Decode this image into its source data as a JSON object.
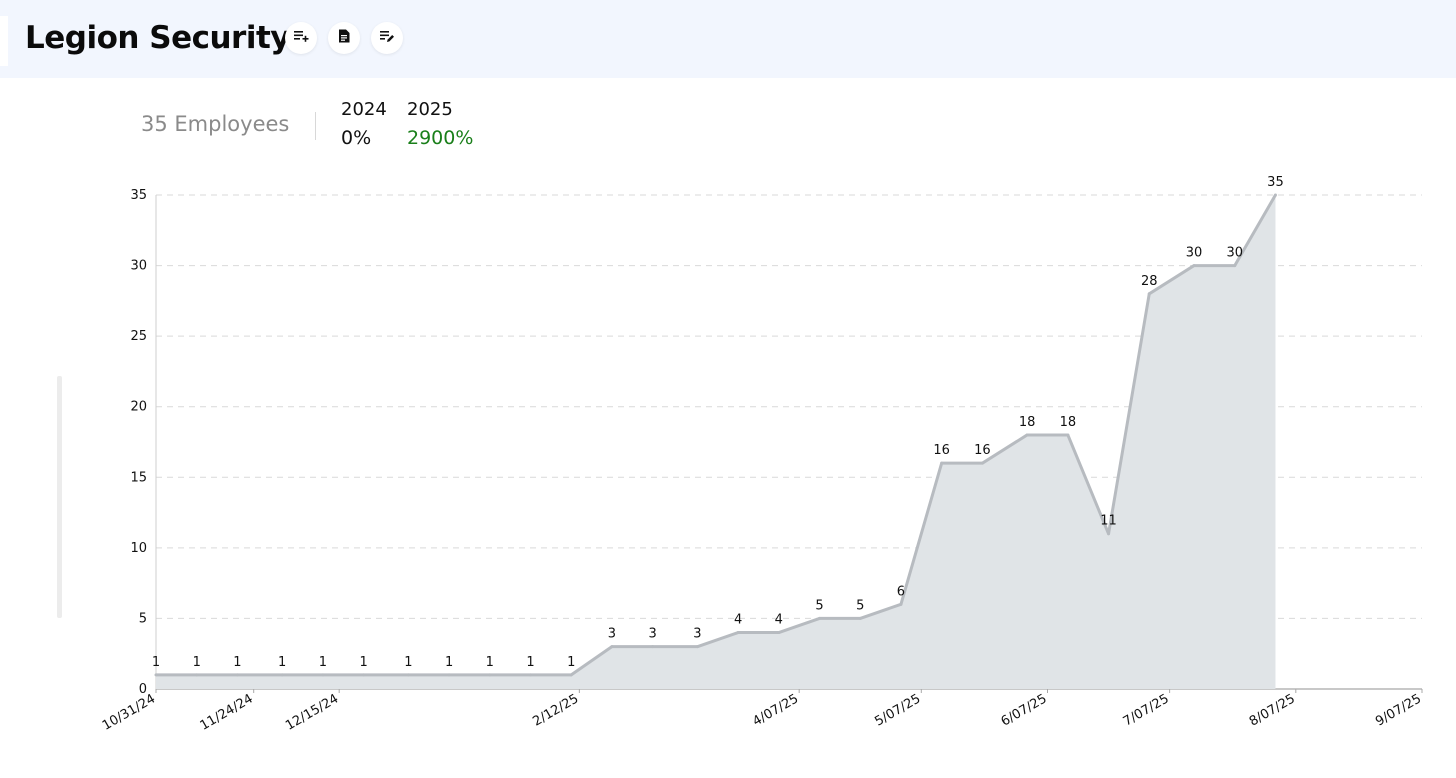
{
  "header": {
    "title": "Legion Security",
    "buttons": [
      {
        "icon": "add-to-list-icon"
      },
      {
        "icon": "document-icon"
      },
      {
        "icon": "edit-list-icon"
      }
    ]
  },
  "stats": {
    "employees_label": "35 Employees",
    "years": [
      {
        "year": "2024",
        "growth": "0%",
        "color": "#111111"
      },
      {
        "year": "2025",
        "growth": "2900%",
        "color": "#1a7f1a"
      }
    ]
  },
  "chart_data": {
    "type": "area",
    "ylim": [
      0,
      35
    ],
    "yticks": [
      "0",
      "5",
      "10",
      "15",
      "20",
      "25",
      "30",
      "35"
    ],
    "xlim": [
      "2024-10-31",
      "2025-09-07"
    ],
    "xticks": [
      "10/31/24",
      "11/24/24",
      "12/15/24",
      "2/12/25",
      "4/07/25",
      "5/07/25",
      "6/07/25",
      "7/07/25",
      "8/07/25",
      "9/07/25"
    ],
    "xtick_dates": [
      "2024-10-31",
      "2024-11-24",
      "2024-12-15",
      "2025-02-12",
      "2025-04-07",
      "2025-05-07",
      "2025-06-07",
      "2025-07-07",
      "2025-08-07",
      "2025-09-07"
    ],
    "points": [
      {
        "date": "2024-10-31",
        "value": 1
      },
      {
        "date": "2024-11-10",
        "value": 1
      },
      {
        "date": "2024-11-20",
        "value": 1
      },
      {
        "date": "2024-12-01",
        "value": 1
      },
      {
        "date": "2024-12-11",
        "value": 1
      },
      {
        "date": "2024-12-21",
        "value": 1
      },
      {
        "date": "2025-01-01",
        "value": 1
      },
      {
        "date": "2025-01-11",
        "value": 1
      },
      {
        "date": "2025-01-21",
        "value": 1
      },
      {
        "date": "2025-01-31",
        "value": 1
      },
      {
        "date": "2025-02-10",
        "value": 1
      },
      {
        "date": "2025-02-20",
        "value": 3
      },
      {
        "date": "2025-03-02",
        "value": 3
      },
      {
        "date": "2025-03-13",
        "value": 3
      },
      {
        "date": "2025-03-23",
        "value": 4
      },
      {
        "date": "2025-04-02",
        "value": 4
      },
      {
        "date": "2025-04-12",
        "value": 5
      },
      {
        "date": "2025-04-22",
        "value": 5
      },
      {
        "date": "2025-05-02",
        "value": 6
      },
      {
        "date": "2025-05-12",
        "value": 16
      },
      {
        "date": "2025-05-22",
        "value": 16
      },
      {
        "date": "2025-06-02",
        "value": 18
      },
      {
        "date": "2025-06-12",
        "value": 18
      },
      {
        "date": "2025-06-22",
        "value": 11
      },
      {
        "date": "2025-07-02",
        "value": 28
      },
      {
        "date": "2025-07-13",
        "value": 30
      },
      {
        "date": "2025-07-23",
        "value": 30
      },
      {
        "date": "2025-08-02",
        "value": 35
      }
    ],
    "grid": true,
    "legend": "none",
    "line_color": "#b7bbc0",
    "fill_color": "#e0e4e7"
  }
}
